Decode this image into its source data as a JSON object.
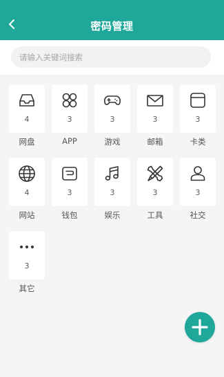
{
  "header": {
    "title": "密码管理",
    "back_icon": "chevron-left-icon",
    "background": "#1fa89a"
  },
  "search": {
    "placeholder": "请输入关键词搜索",
    "value": ""
  },
  "categories": [
    {
      "label": "网盘",
      "count": "4",
      "icon": "inbox-tray-icon"
    },
    {
      "label": "APP",
      "count": "3",
      "icon": "app-grid-icon"
    },
    {
      "label": "游戏",
      "count": "3",
      "icon": "gamepad-icon"
    },
    {
      "label": "邮箱",
      "count": "3",
      "icon": "mail-icon"
    },
    {
      "label": "卡类",
      "count": "3",
      "icon": "card-icon"
    },
    {
      "label": "网站",
      "count": "4",
      "icon": "globe-icon"
    },
    {
      "label": "钱包",
      "count": "3",
      "icon": "wallet-icon"
    },
    {
      "label": "娱乐",
      "count": "3",
      "icon": "music-note-icon"
    },
    {
      "label": "工具",
      "count": "3",
      "icon": "tools-icon"
    },
    {
      "label": "社交",
      "count": "3",
      "icon": "user-icon"
    },
    {
      "label": "其它",
      "count": "3",
      "icon": "more-dots-icon"
    }
  ],
  "fab": {
    "icon": "plus-icon",
    "color": "#1fa89a"
  }
}
